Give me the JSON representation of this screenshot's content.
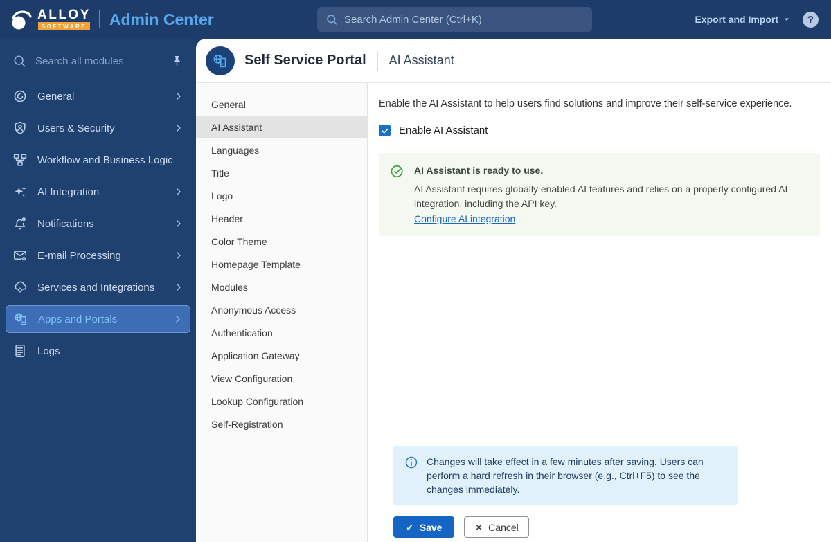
{
  "topbar": {
    "logo": {
      "line1": "ALLOY",
      "line2": "SOFTWARE"
    },
    "app_title": "Admin Center",
    "search_placeholder": "Search Admin Center (Ctrl+K)",
    "export_import_label": "Export and Import",
    "help_label": "?"
  },
  "sidebar": {
    "search_placeholder": "Search all modules",
    "items": [
      {
        "label": "General",
        "icon": "general-icon",
        "chevron": true,
        "selected": false
      },
      {
        "label": "Users & Security",
        "icon": "users-security-icon",
        "chevron": true,
        "selected": false
      },
      {
        "label": "Workflow and Business Logic",
        "icon": "workflow-icon",
        "chevron": false,
        "selected": false
      },
      {
        "label": "AI Integration",
        "icon": "ai-integration-icon",
        "chevron": true,
        "selected": false
      },
      {
        "label": "Notifications",
        "icon": "notifications-icon",
        "chevron": true,
        "selected": false
      },
      {
        "label": "E-mail Processing",
        "icon": "email-processing-icon",
        "chevron": true,
        "selected": false
      },
      {
        "label": "Services and Integrations",
        "icon": "services-integrations-icon",
        "chevron": true,
        "selected": false
      },
      {
        "label": "Apps and Portals",
        "icon": "apps-portals-icon",
        "chevron": true,
        "selected": true
      },
      {
        "label": "Logs",
        "icon": "logs-icon",
        "chevron": false,
        "selected": false
      }
    ]
  },
  "page": {
    "title": "Self Service Portal",
    "subtitle": "AI Assistant"
  },
  "subnav": {
    "selected": "AI Assistant",
    "items": [
      "General",
      "AI Assistant",
      "Languages",
      "Title",
      "Logo",
      "Header",
      "Color Theme",
      "Homepage Template",
      "Modules",
      "Anonymous Access",
      "Authentication",
      "Application Gateway",
      "View Configuration",
      "Lookup Configuration",
      "Self-Registration"
    ]
  },
  "main": {
    "description": "Enable the AI Assistant to help users find solutions and improve their self-service experience.",
    "checkbox": {
      "label": "Enable AI Assistant",
      "checked": true
    },
    "success_panel": {
      "title": "AI Assistant is ready to use.",
      "body": "AI Assistant requires globally enabled AI features and relies on a properly configured AI integration, including the API key.",
      "link": "Configure AI integration"
    }
  },
  "footer": {
    "note": "Changes will take effect in a few minutes after saving. Users can perform a hard refresh in their browser (e.g., Ctrl+F5) to see the changes immediately.",
    "save_label": "Save",
    "cancel_label": "Cancel"
  },
  "colors": {
    "topbar_bg": "#1d3c69",
    "sidebar_bg": "#1f4170",
    "selected_nav_bg": "#3d6db4",
    "accent_blue": "#1565c4",
    "checkbox_blue": "#1a6fc9",
    "success_green": "#43a047",
    "success_bg": "#f3f9f0",
    "info_blue": "#2079c7",
    "info_bg": "#e1f1fc",
    "logo_orange": "#f0a238",
    "title_light_blue": "#58a6ec"
  }
}
